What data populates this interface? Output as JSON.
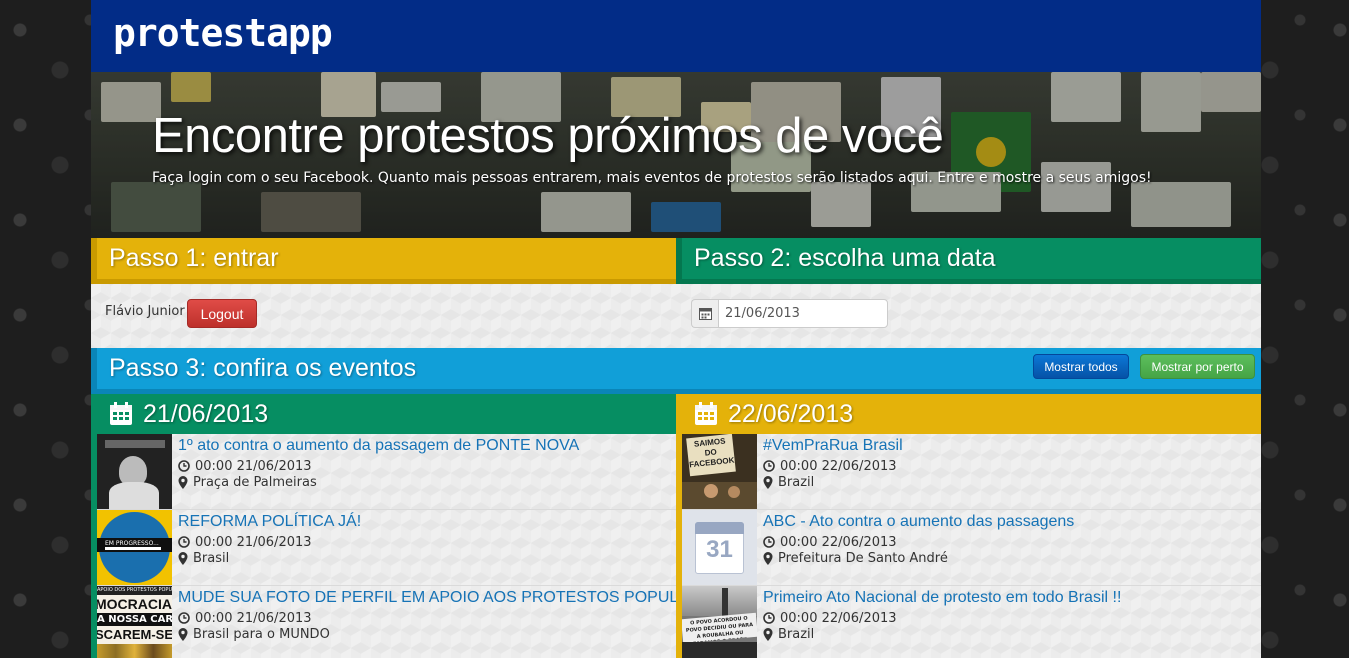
{
  "app": {
    "logo": "protestapp"
  },
  "hero": {
    "title": "Encontre protestos próximos de você",
    "subtitle": "Faça login com o seu Facebook. Quanto mais pessoas entrarem, mais eventos de protestos serão listados aqui. Entre e mostre a seus amigos!"
  },
  "step1": {
    "title": "Passo 1: entrar",
    "user_name": "Flávio Junior",
    "logout_label": "Logout"
  },
  "step2": {
    "title": "Passo 2: escolha uma data",
    "date_value": "21/06/2013"
  },
  "step3": {
    "title": "Passo 3: confira os eventos",
    "show_all_label": "Mostrar todos",
    "show_near_label": "Mostrar por perto"
  },
  "columns": [
    {
      "date": "21/06/2013",
      "color": "#068e62",
      "events": [
        {
          "title": "1º ato contra o aumento da passagem de PONTE NOVA",
          "time": "00:00 21/06/2013",
          "location": "Praça de Palmeiras",
          "thumb": "bw-photo"
        },
        {
          "title": "REFORMA POLÍTICA JÁ!",
          "time": "00:00 21/06/2013",
          "location": "Brasil",
          "thumb": "blue-circle"
        },
        {
          "title": "MUDE SUA FOTO DE PERFIL EM APOIO AOS PROTESTOS POPULARES",
          "time": "00:00 21/06/2013",
          "location": "Brasil para o MUNDO",
          "thumb": "poster"
        }
      ]
    },
    {
      "date": "22/06/2013",
      "color": "#e4b20a",
      "events": [
        {
          "title": "#VemPraRua Brasil",
          "time": "00:00 22/06/2013",
          "location": "Brazil",
          "thumb": "sign"
        },
        {
          "title": "ABC - Ato contra o aumento das passagens",
          "time": "00:00 22/06/2013",
          "location": "Prefeitura De Santo André",
          "thumb": "calendar"
        },
        {
          "title": "Primeiro Ato Nacional de protesto em todo Brasil !!",
          "time": "00:00 22/06/2013",
          "location": "Brazil",
          "thumb": "bw-crowd"
        }
      ]
    }
  ],
  "thumb_text": {
    "blue_circle": "EM PROGRESSO...",
    "poster_lines": [
      "APOIO DOS PROTESTOS POPULARES",
      "MOCRACIA",
      "A NOSSA CARA",
      "SCAREM-SE"
    ],
    "sign_lines": [
      "SAIMOS",
      "DO",
      "FACEBOOK"
    ],
    "calendar_day": "31",
    "crowd_banner": "O POVO ACORDOU O POVO DECIDIU OU PARA A ROUBALHA OU PARAMOS O BRASIL"
  },
  "icons": {
    "calendar": "calendar-icon",
    "clock": "clock-icon",
    "marker": "map-marker-icon"
  }
}
